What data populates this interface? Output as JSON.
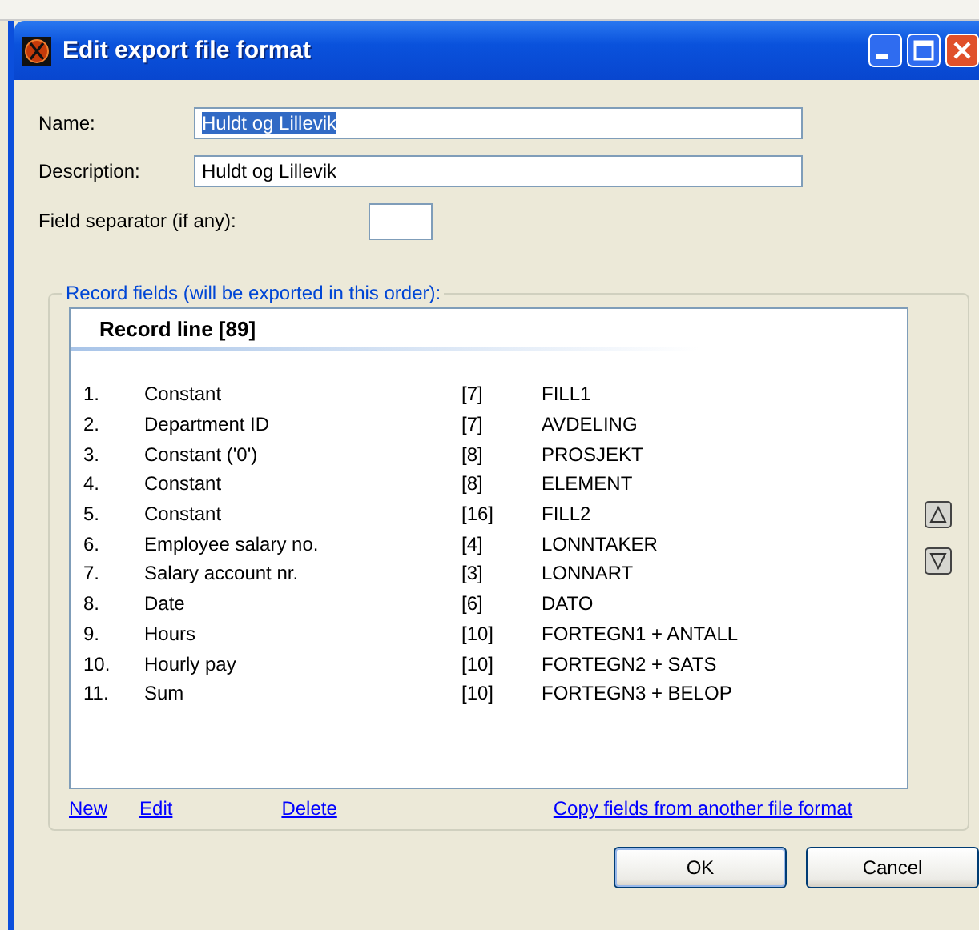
{
  "window": {
    "title": "Edit export file format"
  },
  "fields": [
    {
      "label": "Name:",
      "value": "Huldt og Lillevik",
      "text_selected": true
    },
    {
      "label": "Description:",
      "value": "Huldt og Lillevik",
      "text_selected": false
    }
  ],
  "separator": {
    "label": "Field separator (if any):"
  },
  "record_fields": {
    "legend": "Record fields (will be exported in this order):",
    "header": "Record line [89]",
    "rows": [
      {
        "number": "1.",
        "name": "Constant",
        "length": "[7]",
        "code": "FILL1"
      },
      {
        "number": "2.",
        "name": "Department ID",
        "length": "[7]",
        "code": "AVDELING"
      },
      {
        "number": "3.",
        "name": "Constant ('0')",
        "length": "[8]",
        "code": "PROSJEKT"
      },
      {
        "number": "4.",
        "name": "Constant",
        "length": "[8]",
        "code": "ELEMENT"
      },
      {
        "number": "5.",
        "name": "Constant",
        "length": "[16]",
        "code": "FILL2"
      },
      {
        "number": "6.",
        "name": "Employee salary no.",
        "length": "[4]",
        "code": "LONNTAKER"
      },
      {
        "number": "7.",
        "name": "Salary account nr.",
        "length": "[3]",
        "code": "LONNART"
      },
      {
        "number": "8.",
        "name": "Date",
        "length": "[6]",
        "code": "DATO"
      },
      {
        "number": "9.",
        "name": "Hours",
        "length": "[10]",
        "code": "FORTEGN1 + ANTALL"
      },
      {
        "number": "10.",
        "name": "Hourly pay",
        "length": "[10]",
        "code": "FORTEGN2 + SATS"
      },
      {
        "number": "11.",
        "name": "Sum",
        "length": "[10]",
        "code": "FORTEGN3 + BELOP"
      }
    ],
    "links": [
      "New",
      "Edit",
      "Delete"
    ],
    "copy_link": "Copy fields from another file format"
  },
  "buttons": [
    "OK",
    "Cancel"
  ]
}
